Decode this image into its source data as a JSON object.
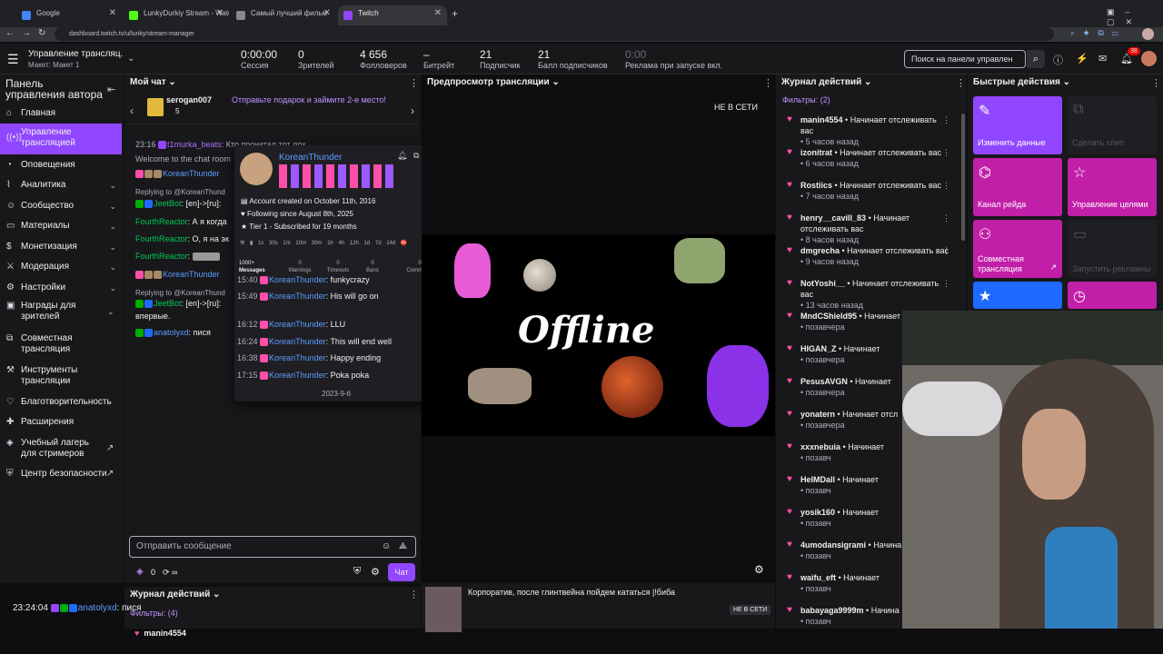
{
  "browser": {
    "tabs": [
      {
        "title": "Google",
        "color": "#4285f4"
      },
      {
        "title": "LunkyDurkiy Stream - Watch Li",
        "color": "#53fc18"
      },
      {
        "title": "Самый лучший фильм",
        "color": "#888888"
      },
      {
        "title": "Twitch",
        "color": "#9146ff"
      }
    ],
    "url": "dashboard.twitch.tv/u/luriky/stream-manager"
  },
  "header": {
    "title": "Управление трансляц...",
    "layout": "Макет: Макет 1",
    "stats": [
      {
        "value": "0:00:00",
        "label": "Сессия"
      },
      {
        "value": "0",
        "label": "Зрителей"
      },
      {
        "value": "4 656",
        "label": "Фолловеров"
      },
      {
        "value": "–",
        "label": "Битрейт"
      },
      {
        "value": "21",
        "label": "Подписчик"
      },
      {
        "value": "21",
        "label": "Балл подписчиков"
      },
      {
        "value": "0:00",
        "label": "Реклама при запуске вкл."
      }
    ],
    "search_placeholder": "Поиск на панели управлен",
    "notif_count": "38"
  },
  "sidebar": {
    "title": "Панель управления автора",
    "items": [
      {
        "label": "Главная",
        "icon": "home-icon"
      },
      {
        "label": "Управление трансляцией",
        "icon": "broadcast-icon"
      },
      {
        "label": "Оповещения",
        "icon": "bell-icon"
      },
      {
        "label": "Аналитика",
        "icon": "chart-icon"
      },
      {
        "label": "Сообщество",
        "icon": "people-icon"
      },
      {
        "label": "Материалы",
        "icon": "folder-icon"
      },
      {
        "label": "Монетизация",
        "icon": "coin-icon"
      },
      {
        "label": "Модерация",
        "icon": "sword-icon"
      },
      {
        "label": "Настройки",
        "icon": "gear-icon"
      },
      {
        "label": "Награды для зрителей",
        "icon": "gift-icon"
      },
      {
        "label": "Совместная трансляция",
        "icon": "collab-icon"
      },
      {
        "label": "Инструменты трансляции",
        "icon": "tools-icon"
      },
      {
        "label": "Благотворительность",
        "icon": "heart-icon"
      },
      {
        "label": "Расширения",
        "icon": "puzzle-icon"
      },
      {
        "label": "Учебный лагерь для стримеров",
        "icon": "academy-icon"
      },
      {
        "label": "Центр безопасности",
        "icon": "shield-icon"
      }
    ]
  },
  "chat": {
    "title": "Мой чат",
    "gift_user": "serogan007",
    "gift_count": "5",
    "gift_text": "Отправьте подарок и займите 2-е место!",
    "messages": [
      {
        "time": "23:16",
        "user": "t1murka_beats",
        "text": "Кто прочитал тот лох"
      },
      {
        "time": "",
        "user": "",
        "text": "Welcome to the chat room"
      },
      {
        "time": "",
        "user": "KoreanThunder",
        "text": ""
      },
      {
        "time": "",
        "user": "",
        "text": "Replying to @KoreanThund"
      },
      {
        "time": "",
        "user": "JeetBot",
        "text": "[en]->[ru]:"
      },
      {
        "time": "",
        "user": "FourthReactor",
        "text": "А я когда"
      },
      {
        "time": "",
        "user": "FourthReactor",
        "text": "О, я на эк"
      },
      {
        "time": "",
        "user": "FourthReactor",
        "text": ""
      },
      {
        "time": "",
        "user": "KoreanThunder",
        "text": ""
      },
      {
        "time": "",
        "user": "",
        "text": "Replying to @KoreanThund"
      },
      {
        "time": "",
        "user": "JeetBot",
        "text": "[en]->[ru]:"
      },
      {
        "time": "",
        "user": "",
        "text": "впервые."
      },
      {
        "time": "",
        "user": "anatolyxd",
        "text": "пися"
      }
    ],
    "input_placeholder": "Отправить сообщение",
    "send_label": "Чат",
    "points": "0"
  },
  "usercard": {
    "name": "KoreanThunder",
    "created": "Account created on October 11th, 2016",
    "following": "Following since August 8th, 2025",
    "tier": "Tier 1 - Subscribed for 19 months",
    "filters": [
      "1s",
      "30s",
      "1m",
      "10m",
      "30m",
      "1h",
      "4h",
      "12h",
      "1d",
      "7d",
      "14d"
    ],
    "tabs": [
      {
        "count": "1000+",
        "label": "Messages"
      },
      {
        "count": "0",
        "label": "Warnings"
      },
      {
        "count": "0",
        "label": "Timeouts"
      },
      {
        "count": "0",
        "label": "Bans"
      },
      {
        "count": "0",
        "label": "Comments"
      }
    ],
    "log": [
      {
        "time": "15:40",
        "text": "funkycrazy"
      },
      {
        "time": "15:49",
        "text": "His  will go on"
      },
      {
        "time": "16:12",
        "text": "LLU"
      },
      {
        "time": "16:24",
        "text": "This will end well"
      },
      {
        "time": "16:38",
        "text": "Happy ending"
      },
      {
        "time": "17:15",
        "text": "Poka poka"
      }
    ],
    "date": "2023-9-6"
  },
  "preview": {
    "title": "Предпросмотр трансляции",
    "status": "НЕ В СЕТИ",
    "offline_text": "Offline",
    "stream_title": "Корпоратив, после глинтвейна пойдем кататься |!биба",
    "badge": "НЕ В СЕТИ"
  },
  "activity": {
    "title": "Журнал действий",
    "filters": "Фильтры: (2)",
    "items": [
      {
        "user": "manin4554",
        "action": "Начинает отслеживать вас",
        "time": "5 часов назад"
      },
      {
        "user": "izonitrat",
        "action": "Начинает отслеживать вас",
        "time": "6 часов назад"
      },
      {
        "user": "Rostiics",
        "action": "Начинает отслеживать вас",
        "time": "7 часов назад"
      },
      {
        "user": "henry__cavill_83",
        "action": "Начинает отслеживать вас",
        "time": "8 часов назад"
      },
      {
        "user": "dmgrecha",
        "action": "Начинает отслеживать вас",
        "time": "9 часов назад"
      },
      {
        "user": "NotYoshi__",
        "action": "Начинает отслеживать вас",
        "time": "13 часов назад"
      },
      {
        "user": "MndCShield95",
        "action": "Начинает",
        "time": "позавчера"
      },
      {
        "user": "HIGAN_Z",
        "action": "Начинает",
        "time": "позавчера"
      },
      {
        "user": "PesusAVGN",
        "action": "Начинает",
        "time": "позавчера"
      },
      {
        "user": "yonatern",
        "action": "Начинает отсл",
        "time": "позавчера"
      },
      {
        "user": "xxxnebuia",
        "action": "Начинает",
        "time": "позавч"
      },
      {
        "user": "HeIMDall",
        "action": "Начинает",
        "time": "позавч"
      },
      {
        "user": "yosik160",
        "action": "Начинает",
        "time": "позавч"
      },
      {
        "user": "4umodansigrami",
        "action": "Начина",
        "time": "позавч"
      },
      {
        "user": "waifu_eft",
        "action": "Начинает",
        "time": "позавч"
      },
      {
        "user": "babayaga9999m",
        "action": "Начина",
        "time": "позавч"
      }
    ]
  },
  "quick": {
    "title": "Быстрые действия",
    "actions": [
      {
        "label": "Изменить данные",
        "color": "#9146ff"
      },
      {
        "label": "Сделать клип",
        "color": "#1f1f23"
      },
      {
        "label": "Канал рейда",
        "color": "#c11fa8"
      },
      {
        "label": "Управление целями",
        "color": "#c11fa8"
      },
      {
        "label": "Совместная трансляция",
        "color": "#c11fa8"
      },
      {
        "label": "Запустить рекламный ролик",
        "color": "#1f1f23"
      },
      {
        "label": "",
        "color": "#1e69ff"
      },
      {
        "label": "",
        "color": "#c11fa8"
      }
    ]
  },
  "bottom": {
    "activity_title": "Журнал действий",
    "filters": "Фильтры: (4)",
    "first_user": "manin4554",
    "overlay_time": "23:24:04",
    "overlay_user": "anatolyxd",
    "overlay_text": "пися"
  }
}
